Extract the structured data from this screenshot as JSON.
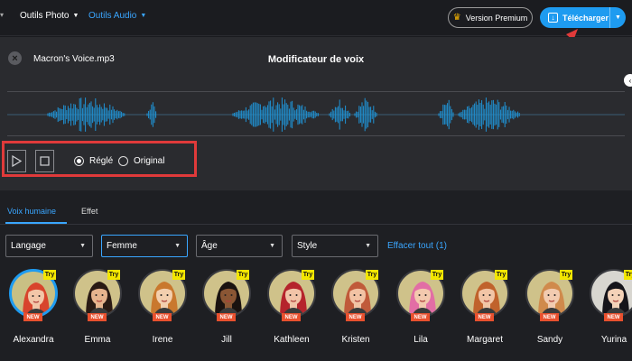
{
  "topbar": {
    "tabs": [
      {
        "label": "Outils Photo",
        "active": false
      },
      {
        "label": "Outils Audio",
        "active": true
      }
    ],
    "premium_label": "Version Premium",
    "download_label": "Télécharger",
    "accent_color": "#1e9bf0",
    "annotation_color": "#e03a3a"
  },
  "editor": {
    "filename": "Macron's Voice.mp3",
    "title": "Modificateur de voix",
    "modes": [
      {
        "label": "Réglé",
        "selected": true
      },
      {
        "label": "Original",
        "selected": false
      }
    ]
  },
  "voices_panel": {
    "tabs": [
      {
        "label": "Voix humaine",
        "active": true
      },
      {
        "label": "Effet",
        "active": false
      }
    ],
    "filters": [
      {
        "value": "Langage",
        "active": false
      },
      {
        "value": "Femme",
        "active": true
      },
      {
        "value": "Âge",
        "active": false
      },
      {
        "value": "Style",
        "active": false
      }
    ],
    "clear_label": "Effacer tout (1)",
    "try_label": "Try",
    "new_label": "NEW",
    "voices": [
      {
        "name": "Alexandra",
        "selected": true,
        "hair": "#d8442c",
        "skin": "#f2c6a8",
        "bg": "#c9c084"
      },
      {
        "name": "Emma",
        "selected": false,
        "hair": "#2a1a14",
        "skin": "#e7b48e",
        "bg": "#cfc28a"
      },
      {
        "name": "Irene",
        "selected": false,
        "hair": "#c9782e",
        "skin": "#f3cfae",
        "bg": "#cfc28a"
      },
      {
        "name": "Jill",
        "selected": false,
        "hair": "#1a1210",
        "skin": "#8a5634",
        "bg": "#cfc28a"
      },
      {
        "name": "Kathleen",
        "selected": false,
        "hair": "#b5242c",
        "skin": "#f1c4a8",
        "bg": "#cfc28a"
      },
      {
        "name": "Kristen",
        "selected": false,
        "hair": "#c05a3a",
        "skin": "#f2c3a4",
        "bg": "#cfc28a"
      },
      {
        "name": "Lila",
        "selected": false,
        "hair": "#e26ea5",
        "skin": "#f3c9ae",
        "bg": "#cfc28a"
      },
      {
        "name": "Margaret",
        "selected": false,
        "hair": "#c0622c",
        "skin": "#f1c5a6",
        "bg": "#cfc28a"
      },
      {
        "name": "Sandy",
        "selected": false,
        "hair": "#d08a4c",
        "skin": "#f2cbb0",
        "bg": "#cfc28a"
      },
      {
        "name": "Yurina",
        "selected": false,
        "hair": "#15141a",
        "skin": "#f4d2b8",
        "bg": "#d8d6d0"
      }
    ]
  }
}
